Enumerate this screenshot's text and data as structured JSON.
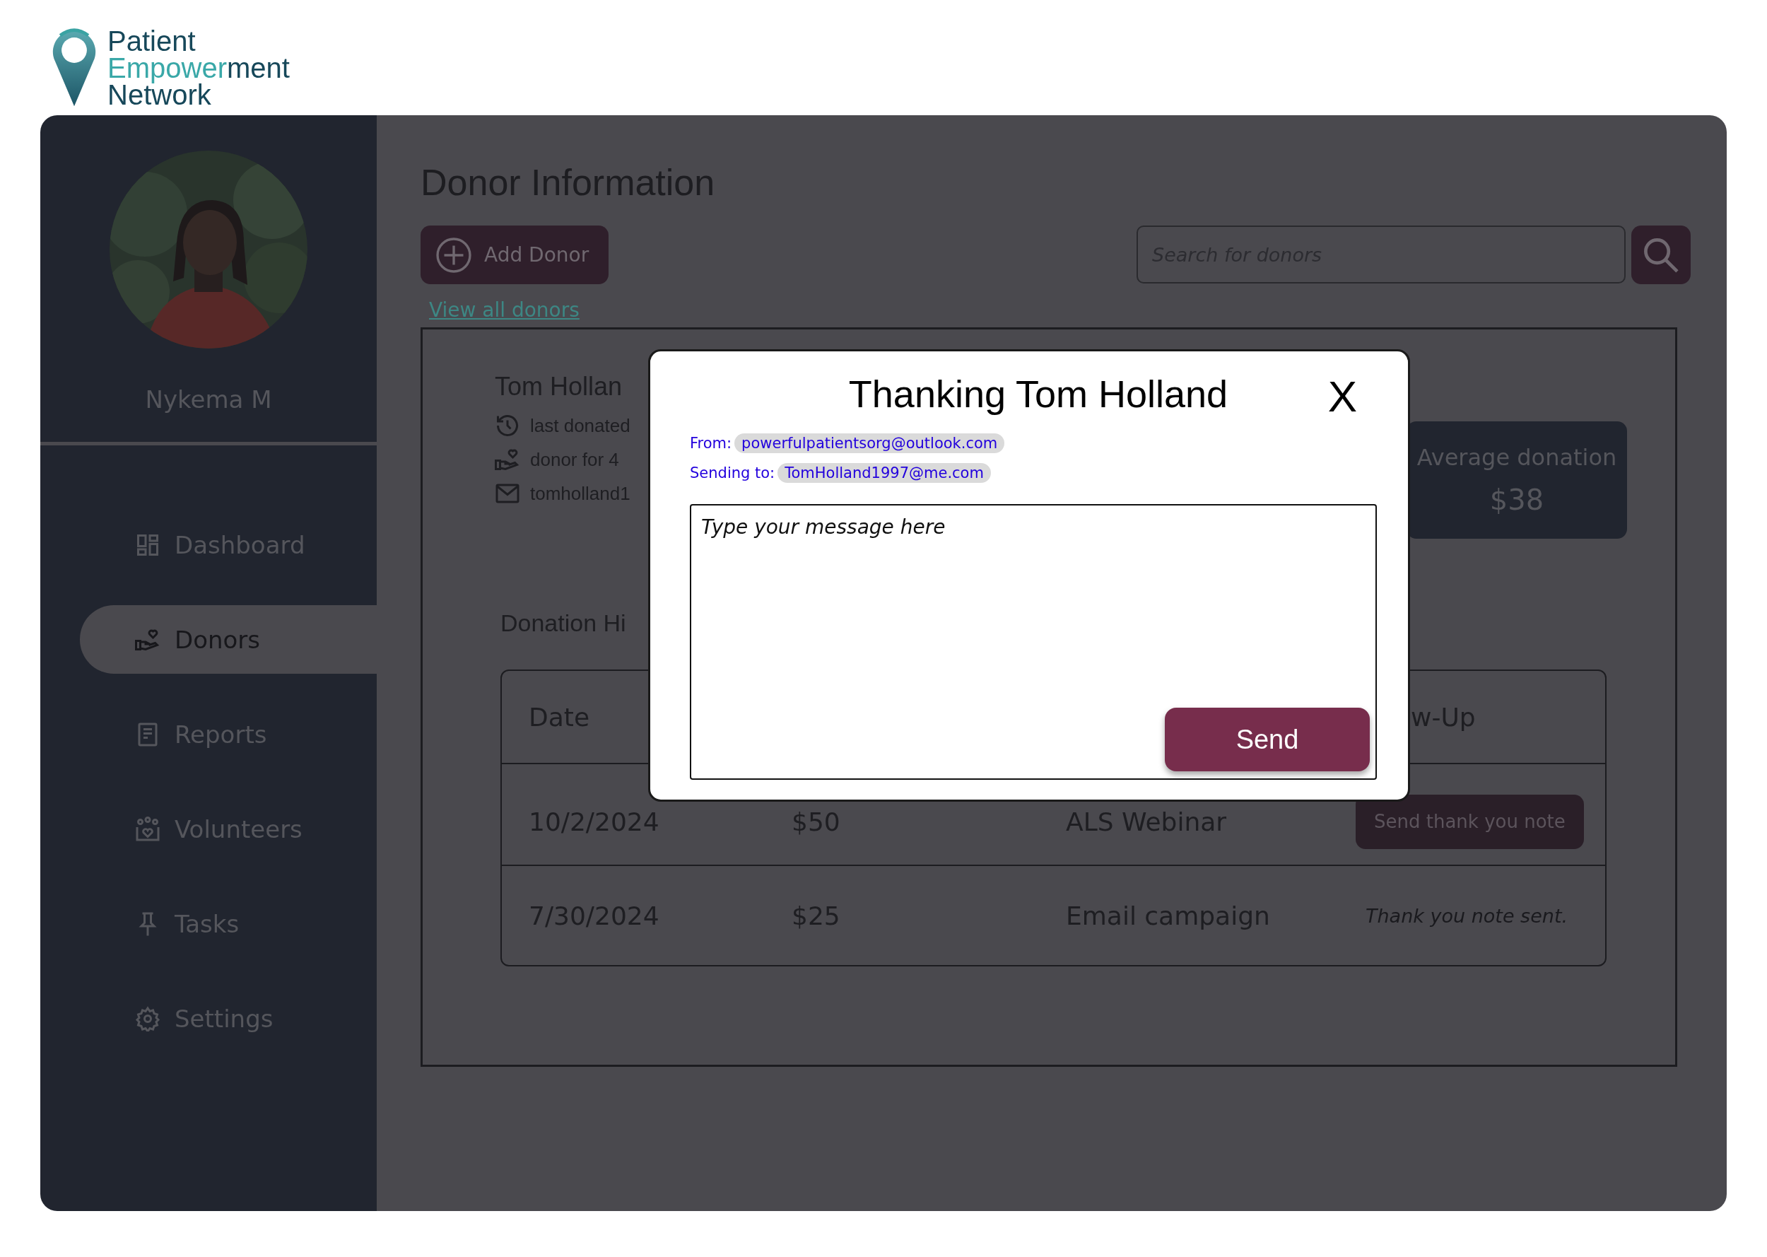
{
  "logo": {
    "line1": "Patient",
    "line2_accent": "Empower",
    "line2_rest": "ment",
    "line3": "Network"
  },
  "user": {
    "name": "Nykema M"
  },
  "sidebar": {
    "items": [
      {
        "label": "Dashboard",
        "selected": false
      },
      {
        "label": "Donors",
        "selected": true
      },
      {
        "label": "Reports",
        "selected": false
      },
      {
        "label": "Volunteers",
        "selected": false
      },
      {
        "label": "Tasks",
        "selected": false
      },
      {
        "label": "Settings",
        "selected": false
      }
    ]
  },
  "page": {
    "title": "Donor Information",
    "add_button": "Add Donor",
    "search": {
      "placeholder": "Search for donors"
    },
    "view_all_link": "View all donors"
  },
  "donor": {
    "name": "Tom Hollan",
    "details": [
      "last donated",
      "donor for 4",
      "tomholland1"
    ],
    "average": {
      "label": "Average donation",
      "value": "$38"
    }
  },
  "history": {
    "title": "Donation Hi",
    "columns": [
      {
        "label": "Date"
      },
      {
        "label": "w-Up"
      }
    ],
    "rows": [
      {
        "date": "10/2/2024",
        "amount": "$50",
        "event": "ALS Webinar",
        "follow_up": {
          "kind": "button",
          "text": "Send thank you note"
        }
      },
      {
        "date": "7/30/2024",
        "amount": "$25",
        "event": "Email campaign",
        "follow_up": {
          "kind": "note",
          "text": "Thank you note sent."
        }
      }
    ]
  },
  "modal": {
    "title": "Thanking Tom Holland",
    "close": "X",
    "from_label": "From:",
    "from": "powerfulpatientsorg@outlook.com",
    "to_label": "Sending to:",
    "to": "TomHolland1997@me.com",
    "message": {
      "placeholder": "Type your message here"
    },
    "send": "Send"
  }
}
